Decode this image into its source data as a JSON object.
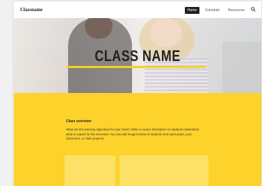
{
  "site": {
    "brand": "Classname",
    "nav": [
      {
        "label": "Home",
        "active": true
      },
      {
        "label": "Schedule",
        "active": false
      },
      {
        "label": "Resources",
        "active": false
      }
    ],
    "search_icon": "search-icon"
  },
  "hero": {
    "title": "CLASS NAME",
    "accent_color": "#f4d21f"
  },
  "overview": {
    "heading": "Class overview",
    "body": "What are the learning objectives for your class? Write a course description so students understand what to expect for the semester. You can add images below of students from past years, your classroom, or class projects.",
    "background": "#fcd22b"
  }
}
